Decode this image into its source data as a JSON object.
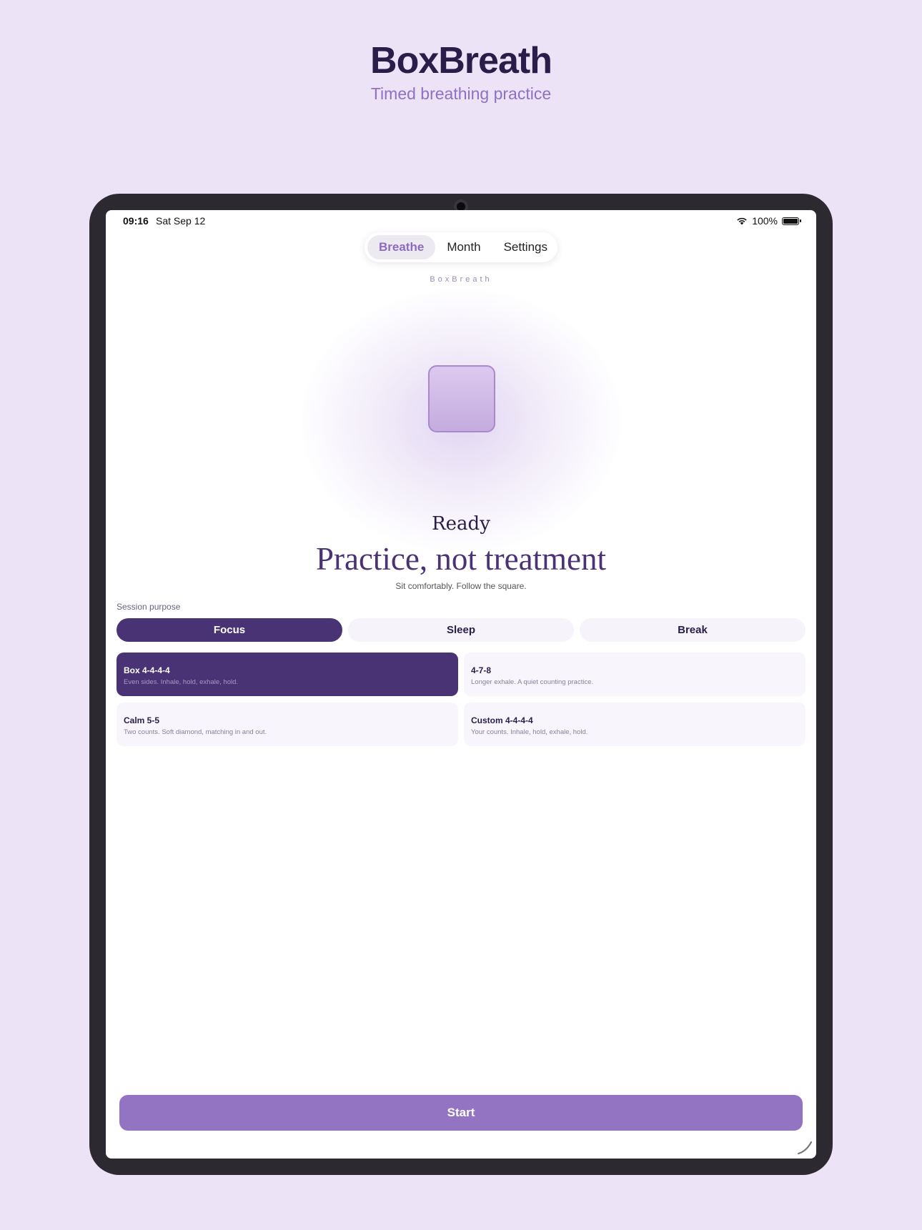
{
  "hero": {
    "title": "BoxBreath",
    "subtitle": "Timed breathing practice"
  },
  "status_bar": {
    "time": "09:16",
    "date": "Sat Sep 12",
    "battery": "100%",
    "icons": [
      "wifi-icon",
      "battery-icon"
    ]
  },
  "tabs": [
    {
      "label": "Breathe",
      "active": true
    },
    {
      "label": "Month",
      "active": false
    },
    {
      "label": "Settings",
      "active": false
    }
  ],
  "brand_caption": "BoxBreath",
  "breathing": {
    "state": "Ready",
    "headline": "Practice, not treatment",
    "instruction": "Sit comfortably. Follow the square."
  },
  "purpose": {
    "label": "Session purpose",
    "options": [
      {
        "label": "Focus",
        "active": true
      },
      {
        "label": "Sleep",
        "active": false
      },
      {
        "label": "Break",
        "active": false
      }
    ]
  },
  "patterns": [
    {
      "name": "Box 4-4-4-4",
      "desc": "Even sides. Inhale, hold, exhale, hold.",
      "active": true
    },
    {
      "name": "4-7-8",
      "desc": "Longer exhale. A quiet counting practice.",
      "active": false
    },
    {
      "name": "Calm 5-5",
      "desc": "Two counts. Soft diamond, matching in and out.",
      "active": false
    },
    {
      "name": "Custom 4-4-4-4",
      "desc": "Your counts. Inhale, hold, exhale, hold.",
      "active": false
    }
  ],
  "start_label": "Start",
  "colors": {
    "background": "#ece3f6",
    "accent_dark": "#4a3375",
    "accent": "#9274c2",
    "title": "#2a1d49"
  }
}
